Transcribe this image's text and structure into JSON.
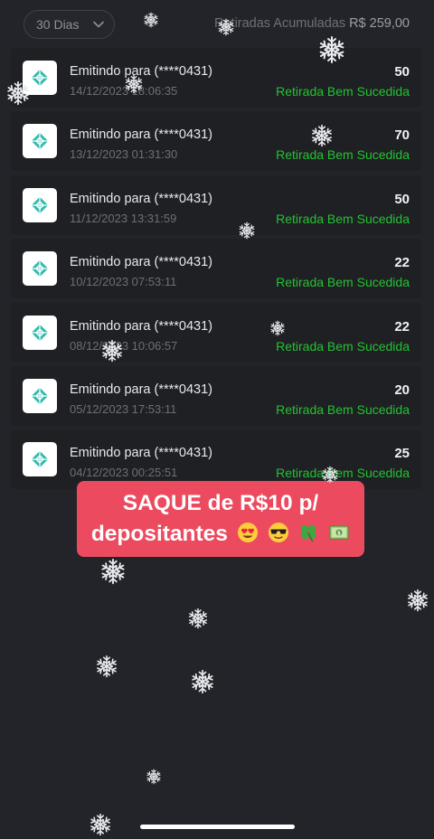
{
  "header": {
    "filter_label": "30 Dias",
    "total_label": "Retiradas Acumuladas",
    "total_value": "R$ 259,00"
  },
  "withdrawals": [
    {
      "title": "Emitindo para (****0431)",
      "date": "14/12/2023 18:06:35",
      "amount": "50",
      "status": "Retirada Bem Sucedida"
    },
    {
      "title": "Emitindo para (****0431)",
      "date": "13/12/2023 01:31:30",
      "amount": "70",
      "status": "Retirada Bem Sucedida"
    },
    {
      "title": "Emitindo para (****0431)",
      "date": "11/12/2023 13:31:59",
      "amount": "50",
      "status": "Retirada Bem Sucedida"
    },
    {
      "title": "Emitindo para (****0431)",
      "date": "10/12/2023 07:53:11",
      "amount": "22",
      "status": "Retirada Bem Sucedida"
    },
    {
      "title": "Emitindo para (****0431)",
      "date": "08/12/2023 10:06:57",
      "amount": "22",
      "status": "Retirada Bem Sucedida"
    },
    {
      "title": "Emitindo para (****0431)",
      "date": "05/12/2023 17:53:11",
      "amount": "20",
      "status": "Retirada Bem Sucedida"
    },
    {
      "title": "Emitindo para (****0431)",
      "date": "04/12/2023 00:25:51",
      "amount": "25",
      "status": "Retirada Bem Sucedida"
    }
  ],
  "banner": {
    "line1": "SAQUE de R$10 p/",
    "line2": "depositantes",
    "emojis": [
      "heart-eyes-emoji",
      "sunglasses-emoji",
      "four-leaf-clover-emoji",
      "money-emoji"
    ]
  },
  "icons": {
    "filter": "chevron-down-icon",
    "row_logo": "pix-logo-icon",
    "decoration": "snowflake-icon"
  },
  "colors": {
    "background": "#232429",
    "success": "#23c232",
    "banner": "#ec4a5f",
    "pix": "#32bcad"
  }
}
